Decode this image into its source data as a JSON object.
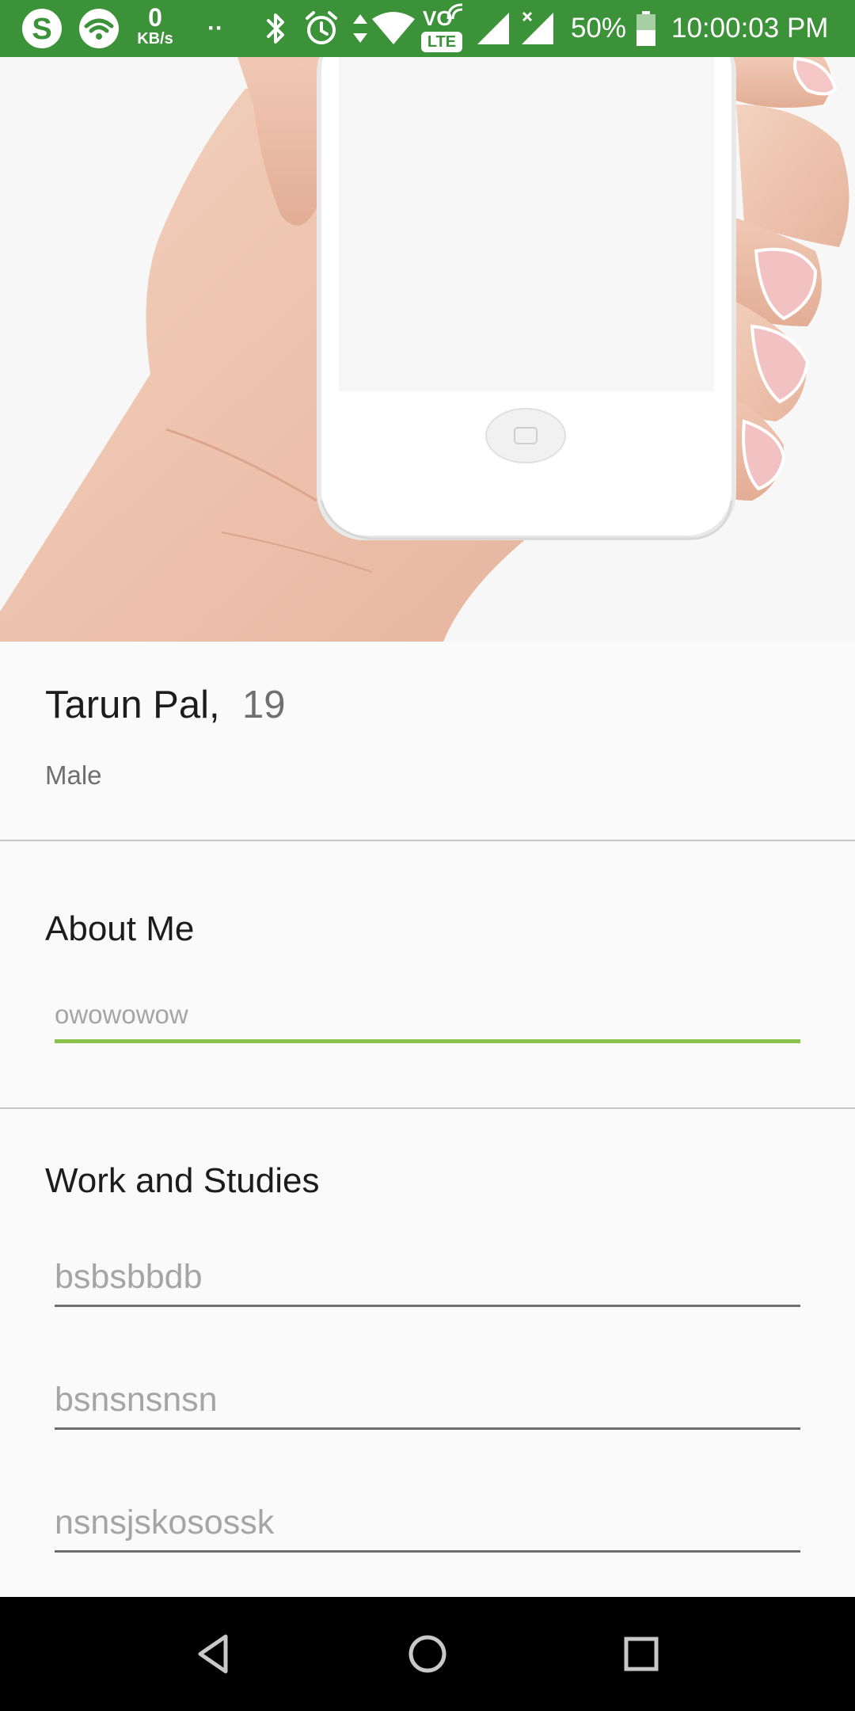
{
  "status_bar": {
    "net_speed_value": "0",
    "net_speed_unit": "KB/s",
    "dots": "··",
    "lte_label": "LTE",
    "vo_label": "VO",
    "battery_percent": "50%",
    "time": "10:00:03 PM",
    "background_color": "#3c9238",
    "icons": [
      "skype-icon",
      "wifi-icon",
      "bluetooth-icon",
      "alarm-icon",
      "data-arrows-icon",
      "wifi-signal-icon",
      "volte-icon",
      "cell-signal-icon",
      "cell-signal-no-data-icon",
      "battery-icon"
    ]
  },
  "profile": {
    "name": "Tarun Pal,",
    "age": "19",
    "gender": "Male"
  },
  "about": {
    "title": "About Me",
    "value": "owowowow",
    "focused": true,
    "accent_color": "#8bc34a"
  },
  "work": {
    "title": "Work and Studies",
    "fields": [
      {
        "value": "bsbsbbdb"
      },
      {
        "value": "bsnsnsnsn"
      },
      {
        "value": "nsnsjskosossk"
      }
    ]
  },
  "nav_bar": {
    "icons": [
      "back-icon",
      "home-icon",
      "recents-icon"
    ]
  }
}
